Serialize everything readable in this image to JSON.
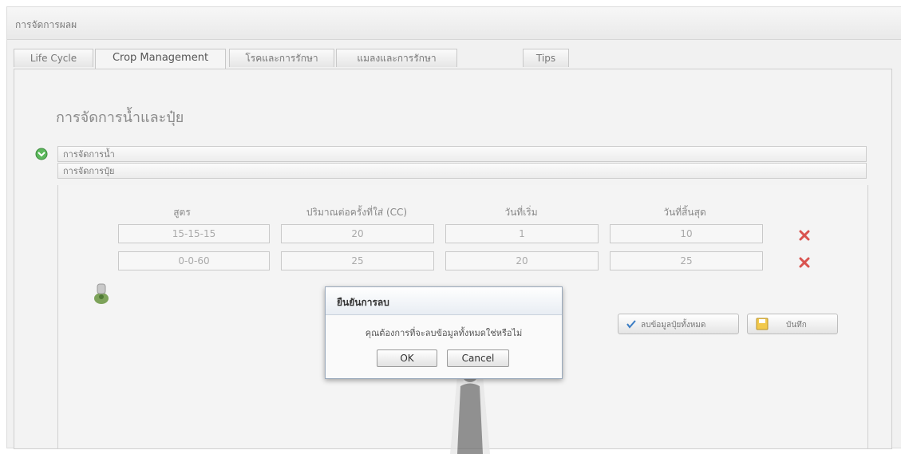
{
  "window": {
    "title": "การจัดการผลผ"
  },
  "tabs": [
    {
      "label": "Life Cycle"
    },
    {
      "label": "Crop Management"
    },
    {
      "label": "โรคและการรักษา"
    },
    {
      "label": "แมลงและการรักษา"
    },
    {
      "label": "Tips"
    }
  ],
  "section": {
    "title": "การจัดการน้ำและปุ๋ย"
  },
  "accordion": {
    "water": "การจัดการน้ำ",
    "fertilizer": "การจัดการปุ๋ย"
  },
  "table": {
    "headers": [
      "สูตร",
      "ปริมาณต่อครั้งที่ใส่ (CC)",
      "วันที่เริ่ม",
      "วันที่สิ้นสุด"
    ],
    "rows": [
      [
        "15-15-15",
        "20",
        "1",
        "10"
      ],
      [
        "0-0-60",
        "25",
        "20",
        "25"
      ]
    ]
  },
  "buttons": {
    "reset": "ลบข้อมูลปุ๋ยทั้งหมด",
    "save": "บันทึก"
  },
  "dialog": {
    "title": "ยืนยันการลบ",
    "message": "คุณต้องการที่จะลบข้อมูลทั้งหมดใช่หรือไม่",
    "ok": "OK",
    "cancel": "Cancel"
  },
  "icons": {
    "delete": "red-x-icon",
    "add": "add-fertilizer-icon",
    "expand": "green-expand-icon",
    "check": "check-icon",
    "save": "floppy-disk-icon"
  },
  "colors": {
    "delete": "#d9534f",
    "expand": "#5cb85c",
    "dialog_border": "#9aa9bb"
  }
}
